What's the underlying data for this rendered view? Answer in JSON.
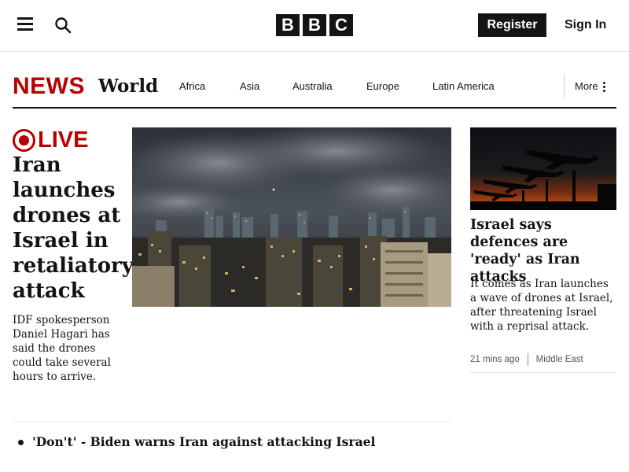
{
  "masthead": {
    "logo_letters": [
      "B",
      "B",
      "C"
    ],
    "register_label": "Register",
    "signin_label": "Sign In",
    "menu_icon": "hamburger-menu-icon",
    "search_icon": "search-icon"
  },
  "section_nav": {
    "news_logo": "NEWS",
    "section_title": "World",
    "links": [
      "Africa",
      "Asia",
      "Australia",
      "Europe",
      "Latin America"
    ],
    "more_label": "More",
    "more_icon": "kebab-menu-icon"
  },
  "lead_story": {
    "live_label": "LIVE",
    "headline": "Iran launches drones at Israel in retaliatory attack",
    "summary": "IDF spokesperson Daniel Hagari has said the drones could take several hours to arrive.",
    "image_desc": "night city skyline"
  },
  "side_story": {
    "headline": "Israel says defences are 'ready' as Iran attacks",
    "summary": "It comes as Iran launches a wave of drones at Israel, after threatening Israel with a reprisal attack.",
    "time": "21 mins ago",
    "tag": "Middle East"
  },
  "related": {
    "items": [
      "'Don't' - Biden warns Iran against attacking Israel"
    ]
  },
  "colors": {
    "news_red": "#b80000",
    "ink": "#141414",
    "meta_grey": "#545658"
  }
}
